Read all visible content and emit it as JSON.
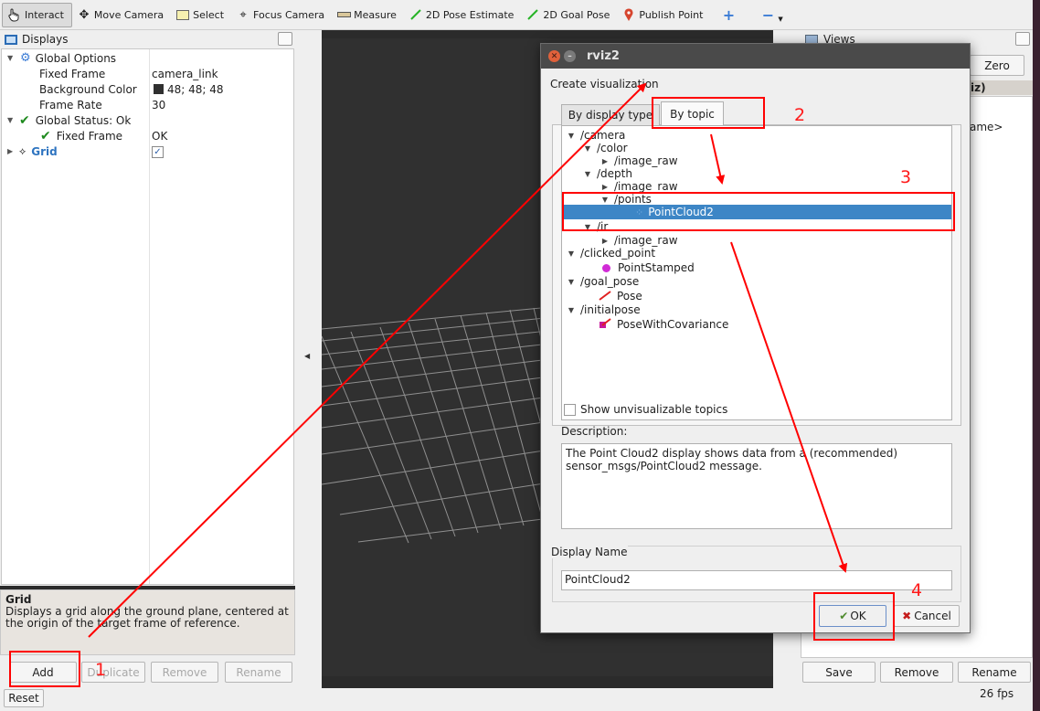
{
  "toolbar": {
    "tools": [
      {
        "name": "interact",
        "label": "Interact",
        "icon": "cursor-icon"
      },
      {
        "name": "move-camera",
        "label": "Move Camera",
        "icon": "move-icon"
      },
      {
        "name": "select",
        "label": "Select",
        "icon": "select-rect-icon"
      },
      {
        "name": "focus-camera",
        "label": "Focus Camera",
        "icon": "crosshair-icon"
      },
      {
        "name": "measure",
        "label": "Measure",
        "icon": "ruler-icon"
      },
      {
        "name": "2d-pose-estimate",
        "label": "2D Pose Estimate",
        "icon": "green-arrow-icon"
      },
      {
        "name": "2d-goal-pose",
        "label": "2D Goal Pose",
        "icon": "green-arrow-icon"
      },
      {
        "name": "publish-point",
        "label": "Publish Point",
        "icon": "map-pin-icon"
      }
    ]
  },
  "displays": {
    "title": "Displays",
    "tree": {
      "global_options": "Global Options",
      "fixed_frame_label": "Fixed Frame",
      "fixed_frame_value": "camera_link",
      "bg_color_label": "Background Color",
      "bg_color_value": "48; 48; 48",
      "frame_rate_label": "Frame Rate",
      "frame_rate_value": "30",
      "global_status": "Global Status: Ok",
      "status_fixed_frame": "Fixed Frame",
      "status_fixed_frame_value": "OK",
      "grid": "Grid"
    },
    "desc_title": "Grid",
    "desc_text": "Displays a grid along the ground plane, centered at the origin of the target frame of reference.",
    "buttons": {
      "add": "Add",
      "duplicate": "Duplicate",
      "remove": "Remove",
      "rename": "Rename"
    }
  },
  "views": {
    "title": "Views",
    "zero": "Zero",
    "fragment1": "iz)",
    "fragment2": "ame>",
    "buttons": {
      "save": "Save",
      "remove": "Remove",
      "rename": "Rename"
    }
  },
  "status": {
    "reset": "Reset",
    "fps": "26 fps"
  },
  "dialog": {
    "title": "rviz2",
    "heading": "Create visualization",
    "tab_display_type": "By display type",
    "tab_topic": "By topic",
    "tree": [
      {
        "label": "/camera",
        "expanded": true
      },
      {
        "label": "/color",
        "expanded": true
      },
      {
        "label": "/image_raw"
      },
      {
        "label": "/depth",
        "expanded": true
      },
      {
        "label": "/image_raw"
      },
      {
        "label": "/points",
        "expanded": true
      },
      {
        "label": "PointCloud2",
        "selected": true
      },
      {
        "label": "/ir",
        "expanded": true
      },
      {
        "label": "/image_raw"
      },
      {
        "label": "/clicked_point"
      },
      {
        "label": "PointStamped"
      },
      {
        "label": "/goal_pose"
      },
      {
        "label": "Pose"
      },
      {
        "label": "/initialpose"
      },
      {
        "label": "PoseWithCovariance"
      }
    ],
    "show_unvis": "Show unvisualizable topics",
    "desc_label": "Description:",
    "desc_text": "The Point Cloud2 display shows data from a (recommended) sensor_msgs/PointCloud2 message.",
    "name_label": "Display Name",
    "name_value": "PointCloud2",
    "ok": "OK",
    "cancel": "Cancel"
  },
  "annotations": [
    "1",
    "2",
    "3",
    "4"
  ],
  "colors": {
    "accent_red": "#ff0000",
    "selection": "#3d86c6",
    "title_bar": "#4a4a4a"
  }
}
